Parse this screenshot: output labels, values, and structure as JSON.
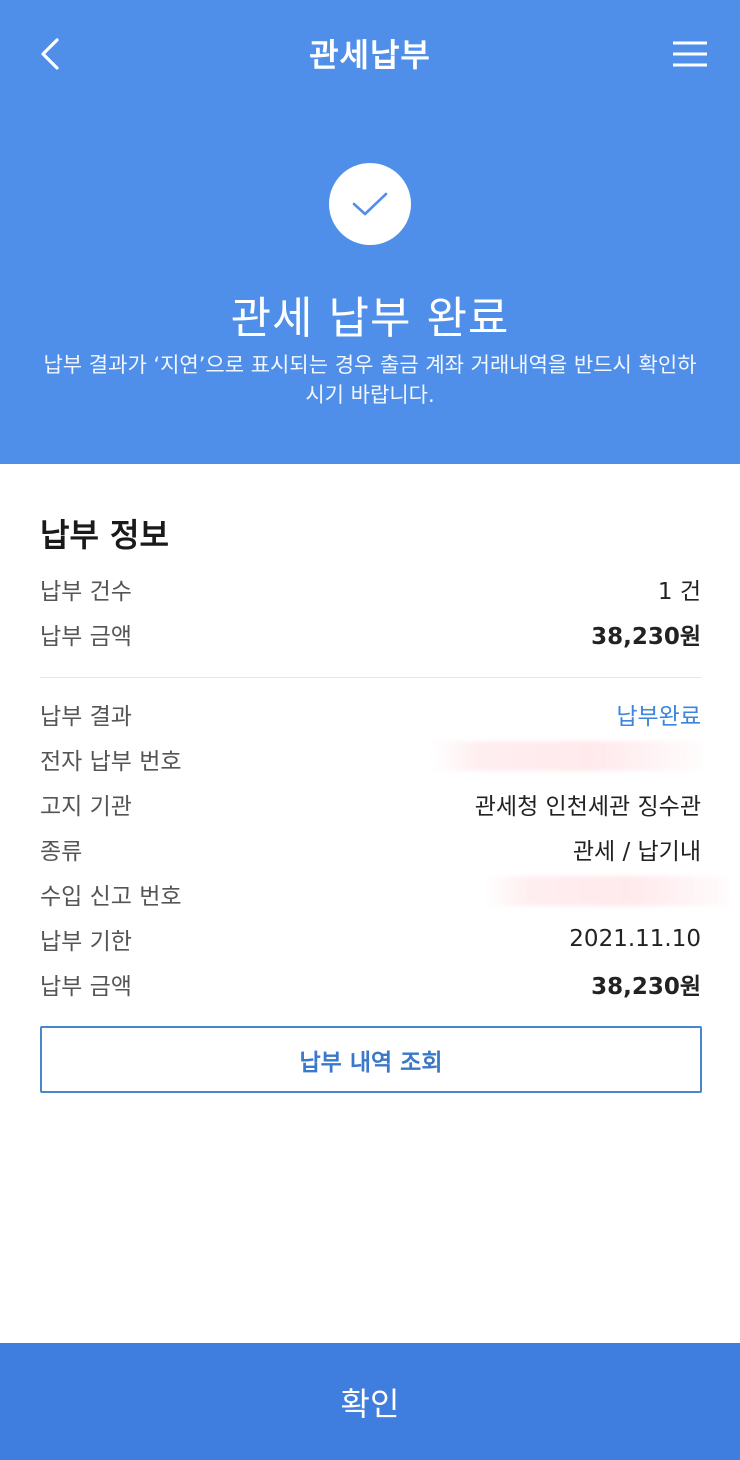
{
  "header": {
    "title": "관세납부",
    "back_icon": "chevron-left-icon",
    "menu_icon": "hamburger-menu-icon"
  },
  "hero": {
    "status_icon": "check-icon",
    "title": "관세 납부 완료",
    "description": "납부 결과가 ‘지연’으로 표시되는 경우 출금 계좌 거래내역을 반드시 확인하시기 바랍니다."
  },
  "summary": {
    "section_title": "납부 정보",
    "rows": [
      {
        "label": "납부 건수",
        "value": "1 건"
      },
      {
        "label": "납부 금액",
        "value": "38,230원"
      }
    ]
  },
  "details": {
    "rows": [
      {
        "label": "납부 결과",
        "value": "납부완료"
      },
      {
        "label": "전자 납부 번호",
        "value": ""
      },
      {
        "label": "고지 기관",
        "value": "관세청 인천세관 징수관"
      },
      {
        "label": "종류",
        "value": "관세 / 납기내"
      },
      {
        "label": "수입 신고 번호",
        "value": ""
      },
      {
        "label": "납부 기한",
        "value": "2021.11.10"
      },
      {
        "label": "납부 금액",
        "value": "38,230원"
      }
    ]
  },
  "actions": {
    "history_label": "납부 내역 조회",
    "confirm_label": "확인"
  },
  "colors": {
    "header_bg": "#4f8fe9",
    "accent": "#3c86dd",
    "confirm_bg": "#3f7ddf"
  }
}
